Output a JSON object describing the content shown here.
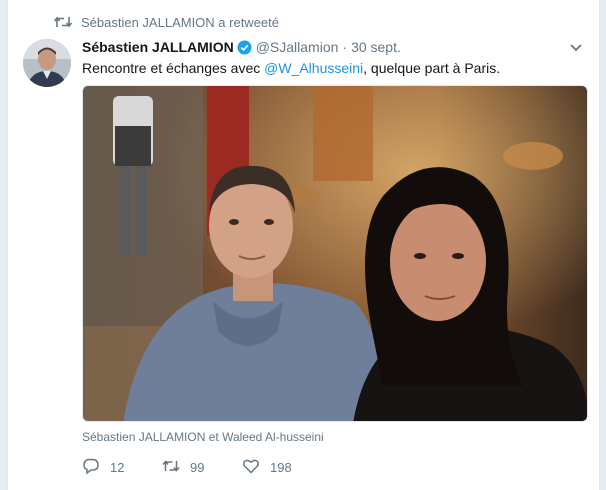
{
  "retweet_context": {
    "icon": "retweet-icon",
    "text": "Sébastien JALLAMION a retweeté"
  },
  "tweet": {
    "fullname": "Sébastien JALLAMION",
    "verified_icon": "verified-badge-icon",
    "handle": "@SJallamion",
    "separator": "·",
    "time": "30 sept.",
    "text_before": "Rencontre et échanges avec ",
    "mention": "@W_Alhusseini",
    "text_after": ", quelque part à Paris.",
    "photo_caption": "Sébastien JALLAMION et Waleed Al-husseini"
  },
  "actions": {
    "reply_count": "12",
    "retweet_count": "99",
    "like_count": "198"
  },
  "colors": {
    "link": "#1b95e0",
    "secondary_text": "#657786",
    "verified": "#1da1f2"
  }
}
